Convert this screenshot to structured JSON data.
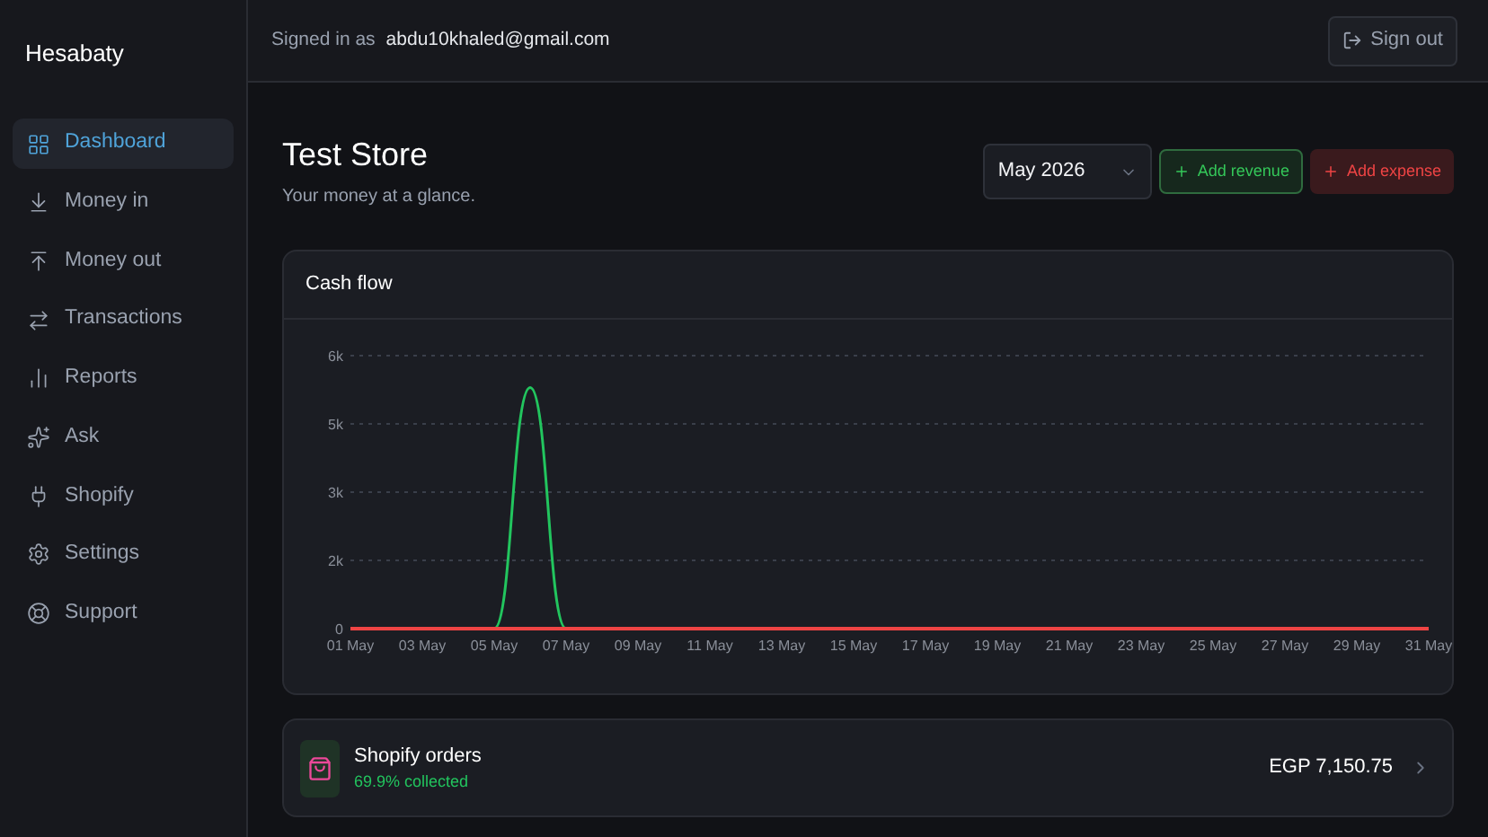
{
  "app": {
    "name": "Hesabaty"
  },
  "sidebar": {
    "items": [
      {
        "label": "Dashboard",
        "selected": true
      },
      {
        "label": "Money in",
        "selected": false
      },
      {
        "label": "Money out",
        "selected": false
      },
      {
        "label": "Transactions",
        "selected": false
      },
      {
        "label": "Reports",
        "selected": false
      },
      {
        "label": "Ask",
        "selected": false
      },
      {
        "label": "Shopify",
        "selected": false
      },
      {
        "label": "Settings",
        "selected": false
      },
      {
        "label": "Support",
        "selected": false
      }
    ]
  },
  "header": {
    "signed_in_label": "Signed in as",
    "email": "abdu10khaled@gmail.com",
    "sign_out": "Sign out"
  },
  "page": {
    "title": "Test Store",
    "subtitle": "Your money at a glance.",
    "month": "May 2026",
    "add_revenue": "Add revenue",
    "add_expense": "Add expense"
  },
  "cash_flow": {
    "title": "Cash flow",
    "chart_data": {
      "type": "line",
      "categories": [
        "01 May",
        null,
        "03 May",
        null,
        "05 May",
        null,
        "07 May",
        null,
        "09 May",
        null,
        "11 May",
        null,
        "13 May",
        null,
        "15 May",
        null,
        "17 May",
        null,
        "19 May",
        null,
        "21 May",
        null,
        "23 May",
        null,
        "25 May",
        null,
        "27 May",
        null,
        "29 May",
        null,
        "31 May"
      ],
      "series": [
        {
          "color": "#22c55e",
          "values": [
            null,
            null,
            null,
            null,
            0,
            5300,
            0,
            null,
            null,
            null,
            null,
            null,
            null,
            null,
            null,
            null,
            null,
            null,
            null,
            null,
            null,
            null,
            null,
            null,
            null,
            null,
            null,
            null,
            null,
            null,
            null
          ]
        },
        {
          "color": "#ef4444",
          "values": [
            0,
            0,
            0,
            0,
            0,
            0,
            0,
            0,
            0,
            0,
            0,
            0,
            0,
            0,
            0,
            0,
            0,
            0,
            0,
            0,
            0,
            0,
            0,
            0,
            0,
            0,
            0,
            0,
            0,
            0,
            0
          ]
        }
      ],
      "ylim": [
        0,
        6000
      ],
      "grid": true,
      "yticks": [
        {
          "value": 0,
          "label": "0"
        },
        {
          "value": 1500,
          "label": "2k"
        },
        {
          "value": 3000,
          "label": "3k"
        },
        {
          "value": 4500,
          "label": "5k"
        },
        {
          "value": 6000,
          "label": "6k"
        }
      ]
    }
  },
  "shopify_orders": {
    "title": "Shopify orders",
    "collected": "69.9% collected",
    "amount": "EGP 7,150.75"
  }
}
